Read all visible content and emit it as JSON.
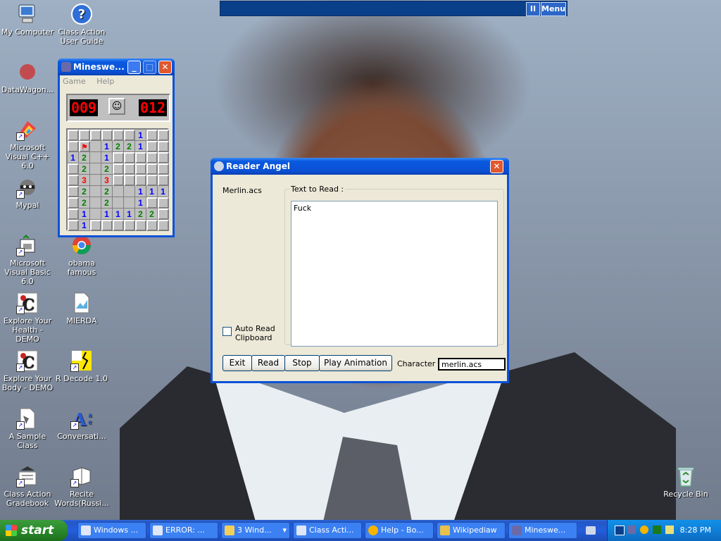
{
  "desktop": {
    "icons": [
      {
        "label": "My Computer",
        "icon": "my-computer-icon"
      },
      {
        "label": "Class Action User Guide",
        "icon": "help-icon"
      },
      {
        "label": "DataWagon...",
        "icon": "datawagon-icon"
      },
      {
        "label": "Microsoft Visual C++ 6.0",
        "icon": "visual-cpp-icon"
      },
      {
        "label": "Mypal",
        "icon": "raccoon-icon"
      },
      {
        "label": "Microsoft Visual Basic 6.0",
        "icon": "visual-basic-icon"
      },
      {
        "label": "obama famous",
        "icon": "chrome-icon"
      },
      {
        "label": "Explore Your Health - DEMO",
        "icon": "class-action-icon"
      },
      {
        "label": "MIERDA",
        "icon": "image-file-icon"
      },
      {
        "label": "Explore Your Body - DEMO",
        "icon": "class-action-icon"
      },
      {
        "label": "R Decode 1.0",
        "icon": "rdecode-icon"
      },
      {
        "label": "A Sample Class",
        "icon": "sample-class-icon"
      },
      {
        "label": "Conversati...",
        "icon": "conversation-icon"
      },
      {
        "label": "Class Action Gradebook",
        "icon": "gradebook-icon"
      },
      {
        "label": "Recite Words(Russi...",
        "icon": "recite-words-icon"
      },
      {
        "label": "Recycle Bin",
        "icon": "recycle-bin-icon"
      }
    ]
  },
  "topbar": {
    "pause_label": "II",
    "menu_label": "Menu"
  },
  "minesweeper": {
    "title": "Mineswe...",
    "menu": [
      "Game",
      "Help"
    ],
    "mine_counter": "009",
    "timer": "012",
    "smiley": "☺",
    "grid": [
      [
        "c",
        "c",
        "c",
        "c",
        "c",
        "c",
        "1",
        "c",
        "c"
      ],
      [
        "c",
        "f",
        "o",
        "1",
        "2",
        "2",
        "1",
        "c",
        "c"
      ],
      [
        "1",
        "2",
        "o",
        "1",
        "c",
        "c",
        "c",
        "c",
        "c"
      ],
      [
        "c",
        "2",
        "o",
        "2",
        "c",
        "c",
        "c",
        "c",
        "c"
      ],
      [
        "c",
        "3",
        "o",
        "3",
        "c",
        "c",
        "c",
        "c",
        "c"
      ],
      [
        "c",
        "2",
        "o",
        "2",
        "o",
        "o",
        "1",
        "1",
        "1"
      ],
      [
        "c",
        "2",
        "o",
        "2",
        "o",
        "o",
        "1",
        "c",
        "c"
      ],
      [
        "c",
        "1",
        "o",
        "1",
        "1",
        "1",
        "2",
        "2",
        "c"
      ],
      [
        "c",
        "1",
        "c",
        "c",
        "c",
        "c",
        "c",
        "c",
        "c"
      ]
    ]
  },
  "reader": {
    "title": "Reader Angel",
    "agent_file": "Merlin.acs",
    "text_group_label": "Text to Read :",
    "text_value": "Fuck",
    "auto_read_label": "Auto Read Clipboard",
    "auto_read_checked": false,
    "buttons": {
      "exit": "Exit",
      "read": "Read",
      "stop": "Stop",
      "play": "Play Animation"
    },
    "character_label": "Character",
    "character_value": "merlin.acs"
  },
  "taskbar": {
    "start_label": "start",
    "tasks": [
      "Windows ...",
      "ERROR: ...",
      "3 Wind...",
      "Class Acti...",
      "Help - Bo...",
      "Wikipediaw",
      "Mineswe..."
    ],
    "clock": "8:28 PM"
  },
  "colors": {
    "titlebar": "#0a4fd3",
    "close": "#e0582e",
    "taskbar": "#245edb",
    "start": "#2b8a2b",
    "tray": "#0f7fd8"
  }
}
